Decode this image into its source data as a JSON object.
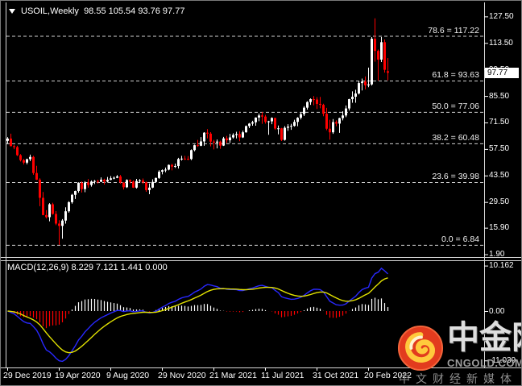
{
  "header": {
    "symbol_label": "USOIL,Weekly",
    "ohlc_readout": "98.55 105.54 93.76 97.77"
  },
  "price_axis": {
    "labels": [
      "127.50",
      "113.50",
      "99.50",
      "85.50",
      "71.50",
      "57.50",
      "43.50",
      "29.50",
      "15.90",
      "1.90"
    ],
    "current_price": "97.77"
  },
  "fibonacci_levels": [
    {
      "label": "78.6 = 117.22",
      "value": 117.22
    },
    {
      "label": "61.8 = 93.63",
      "value": 93.63
    },
    {
      "label": "50.0 = 77.06",
      "value": 77.06
    },
    {
      "label": "38.2 = 60.48",
      "value": 60.48
    },
    {
      "label": "23.6 = 39.98",
      "value": 39.98
    },
    {
      "label": "0.0 = 6.84",
      "value": 6.84
    }
  ],
  "macd_panel": {
    "header": "MACD(12,26,9) 8.229 7.121 1.441 0.000",
    "axis_labels": [
      {
        "text": "10.162",
        "value": 10.162
      },
      {
        "text": "0.00",
        "value": 0
      },
      {
        "text": "-11.039",
        "value": -11.039
      }
    ]
  },
  "time_axis": {
    "labels": [
      "29 Dec 2019",
      "19 Apr 2020",
      "9 Aug 2020",
      "29 Nov 2020",
      "21 Mar 2021",
      "11 Jul 2021",
      "31 Oct 2021",
      "20 Feb 2022"
    ]
  },
  "watermark": {
    "brand": "中金网",
    "url": "CNGOLD.COM.CN",
    "tagline": "中文财经新媒体"
  },
  "colors": {
    "background": "#000000",
    "bull": "#ffffff",
    "bear": "#ff0000",
    "macd_line": "#2828ff",
    "signal_line": "#e2e200",
    "hist_up": "#ffffff",
    "hist_down": "#ff0000",
    "fib_line": "#cfcfcf",
    "axis_text": "#ffffff",
    "price_tag_bg": "#ffffff",
    "price_tag_text": "#000000",
    "logo_red": "#e23b1e"
  },
  "chart_data": {
    "type": "candlestick",
    "symbol": "USOIL",
    "timeframe": "Weekly",
    "note": "weekly OHLC candles, left-to-right; MACD(12,26,9) lines and OsMA histogram in sub-panel are derived from closes",
    "ylim": [
      1.9,
      131.0
    ],
    "macd_ylim": [
      -12.3,
      10.7
    ],
    "candles": [
      [
        61.8,
        63.8,
        60.4,
        63.0
      ],
      [
        63.0,
        65.6,
        58.9,
        59.0
      ],
      [
        59.0,
        59.7,
        57.4,
        58.5
      ],
      [
        58.5,
        59.2,
        53.8,
        54.2
      ],
      [
        54.2,
        54.8,
        50.9,
        51.6
      ],
      [
        51.6,
        52.3,
        49.3,
        50.3
      ],
      [
        50.3,
        52.4,
        49.4,
        52.1
      ],
      [
        52.1,
        54.5,
        51.1,
        53.3
      ],
      [
        53.3,
        53.9,
        43.9,
        44.8
      ],
      [
        44.8,
        48.6,
        41.1,
        41.3
      ],
      [
        41.3,
        42.0,
        27.3,
        31.7
      ],
      [
        31.7,
        34.8,
        22.5,
        22.6
      ],
      [
        22.6,
        25.2,
        20.8,
        21.5
      ],
      [
        21.5,
        28.9,
        19.3,
        28.3
      ],
      [
        28.3,
        29.1,
        22.8,
        23.2
      ],
      [
        23.2,
        24.7,
        17.3,
        18.1
      ],
      [
        18.1,
        19.9,
        6.84,
        16.9
      ],
      [
        16.9,
        20.5,
        10.1,
        19.7
      ],
      [
        19.7,
        26.7,
        18.1,
        24.6
      ],
      [
        24.6,
        29.9,
        23.9,
        29.4
      ],
      [
        29.4,
        33.8,
        28.6,
        33.3
      ],
      [
        33.3,
        35.5,
        31.1,
        35.3
      ],
      [
        35.3,
        39.9,
        34.4,
        39.6
      ],
      [
        39.6,
        40.4,
        34.5,
        36.3
      ],
      [
        36.3,
        40.5,
        34.7,
        39.8
      ],
      [
        39.8,
        41.6,
        37.1,
        38.5
      ],
      [
        38.5,
        40.9,
        37.6,
        40.3
      ],
      [
        40.3,
        41.1,
        39.0,
        40.6
      ],
      [
        40.6,
        41.3,
        39.2,
        40.2
      ],
      [
        40.2,
        42.5,
        40.0,
        41.3
      ],
      [
        41.3,
        41.8,
        38.7,
        40.3
      ],
      [
        40.3,
        42.7,
        39.8,
        41.2
      ],
      [
        41.2,
        43.2,
        41.0,
        42.0
      ],
      [
        42.0,
        43.0,
        41.5,
        42.3
      ],
      [
        42.3,
        43.7,
        42.1,
        43.0
      ],
      [
        43.0,
        43.8,
        39.2,
        39.8
      ],
      [
        39.8,
        39.9,
        36.1,
        37.3
      ],
      [
        37.3,
        41.5,
        36.9,
        41.1
      ],
      [
        41.1,
        41.5,
        39.3,
        40.3
      ],
      [
        40.3,
        40.9,
        36.9,
        37.1
      ],
      [
        37.1,
        41.7,
        36.6,
        40.6
      ],
      [
        40.6,
        41.6,
        39.6,
        40.9
      ],
      [
        40.9,
        41.9,
        39.0,
        39.9
      ],
      [
        39.9,
        40.3,
        34.9,
        35.8
      ],
      [
        35.8,
        39.3,
        33.6,
        37.1
      ],
      [
        37.1,
        41.5,
        36.8,
        40.1
      ],
      [
        40.1,
        42.4,
        40.0,
        42.2
      ],
      [
        42.2,
        46.3,
        41.7,
        45.5
      ],
      [
        45.5,
        46.7,
        44.1,
        46.3
      ],
      [
        46.3,
        47.7,
        45.2,
        46.6
      ],
      [
        46.6,
        49.3,
        46.2,
        49.1
      ],
      [
        49.1,
        49.7,
        46.2,
        48.2
      ],
      [
        48.2,
        49.8,
        47.5,
        48.5
      ],
      [
        48.5,
        52.8,
        47.2,
        52.2
      ],
      [
        52.2,
        53.9,
        51.4,
        52.4
      ],
      [
        52.4,
        53.9,
        51.7,
        52.3
      ],
      [
        52.3,
        53.8,
        51.6,
        52.2
      ],
      [
        52.2,
        57.3,
        51.6,
        56.9
      ],
      [
        56.9,
        59.8,
        56.3,
        59.5
      ],
      [
        59.5,
        62.3,
        58.6,
        59.2
      ],
      [
        59.2,
        63.8,
        59.0,
        61.5
      ],
      [
        61.5,
        66.4,
        59.2,
        66.1
      ],
      [
        66.1,
        68.0,
        63.1,
        65.6
      ],
      [
        65.6,
        66.4,
        58.9,
        61.4
      ],
      [
        61.4,
        62.3,
        57.3,
        60.9
      ],
      [
        60.9,
        62.5,
        57.8,
        61.4
      ],
      [
        61.4,
        61.9,
        57.6,
        59.3
      ],
      [
        59.3,
        63.9,
        59.1,
        63.1
      ],
      [
        63.1,
        64.4,
        60.6,
        62.1
      ],
      [
        62.1,
        65.5,
        60.7,
        63.6
      ],
      [
        63.6,
        65.8,
        63.0,
        64.9
      ],
      [
        64.9,
        66.6,
        63.1,
        65.4
      ],
      [
        65.4,
        66.9,
        61.6,
        63.6
      ],
      [
        63.6,
        67.2,
        63.3,
        66.3
      ],
      [
        66.3,
        69.9,
        66.1,
        69.6
      ],
      [
        69.6,
        71.2,
        68.5,
        70.9
      ],
      [
        70.9,
        72.4,
        69.8,
        71.6
      ],
      [
        71.6,
        74.2,
        69.8,
        74.1
      ],
      [
        74.1,
        76.2,
        72.2,
        75.2
      ],
      [
        75.2,
        77.0,
        70.8,
        74.6
      ],
      [
        74.6,
        75.5,
        70.9,
        71.8
      ],
      [
        71.8,
        72.4,
        65.0,
        72.1
      ],
      [
        72.1,
        74.2,
        70.6,
        73.9
      ],
      [
        73.9,
        74.0,
        67.6,
        68.3
      ],
      [
        68.3,
        69.9,
        65.2,
        68.4
      ],
      [
        68.4,
        68.6,
        61.7,
        62.3
      ],
      [
        62.3,
        69.6,
        61.9,
        68.7
      ],
      [
        68.7,
        70.6,
        67.1,
        69.3
      ],
      [
        69.3,
        70.8,
        67.6,
        69.7
      ],
      [
        69.7,
        72.9,
        69.3,
        71.8
      ],
      [
        71.8,
        74.3,
        69.5,
        74.0
      ],
      [
        74.0,
        76.7,
        73.1,
        75.9
      ],
      [
        75.9,
        80.1,
        74.9,
        79.3
      ],
      [
        79.3,
        82.7,
        78.3,
        82.3
      ],
      [
        82.3,
        84.2,
        80.8,
        83.8
      ],
      [
        83.8,
        85.4,
        80.6,
        83.6
      ],
      [
        83.6,
        84.9,
        78.6,
        81.3
      ],
      [
        81.3,
        85.0,
        79.0,
        80.8
      ],
      [
        80.8,
        81.4,
        74.8,
        76.1
      ],
      [
        76.1,
        79.2,
        67.4,
        68.2
      ],
      [
        68.2,
        72.9,
        62.4,
        66.3
      ],
      [
        66.3,
        73.3,
        65.5,
        71.7
      ],
      [
        71.7,
        72.6,
        69.5,
        70.9
      ],
      [
        70.9,
        74.0,
        66.0,
        73.8
      ],
      [
        73.8,
        77.4,
        72.6,
        75.2
      ],
      [
        75.2,
        80.5,
        74.3,
        78.9
      ],
      [
        78.9,
        84.0,
        77.8,
        83.8
      ],
      [
        83.8,
        87.9,
        81.9,
        85.1
      ],
      [
        85.1,
        88.8,
        81.9,
        86.8
      ],
      [
        86.8,
        93.2,
        86.3,
        92.3
      ],
      [
        92.3,
        94.7,
        88.4,
        93.1
      ],
      [
        93.1,
        95.8,
        89.0,
        91.1
      ],
      [
        91.1,
        100.5,
        90.1,
        91.6
      ],
      [
        91.6,
        116.6,
        91.0,
        115.7
      ],
      [
        115.7,
        126.5,
        103.6,
        109.3
      ],
      [
        109.3,
        110.0,
        93.6,
        104.7
      ],
      [
        104.7,
        116.6,
        103.4,
        113.9
      ],
      [
        113.9,
        115.3,
        97.8,
        99.3
      ],
      [
        98.55,
        105.54,
        93.76,
        97.77
      ]
    ]
  }
}
